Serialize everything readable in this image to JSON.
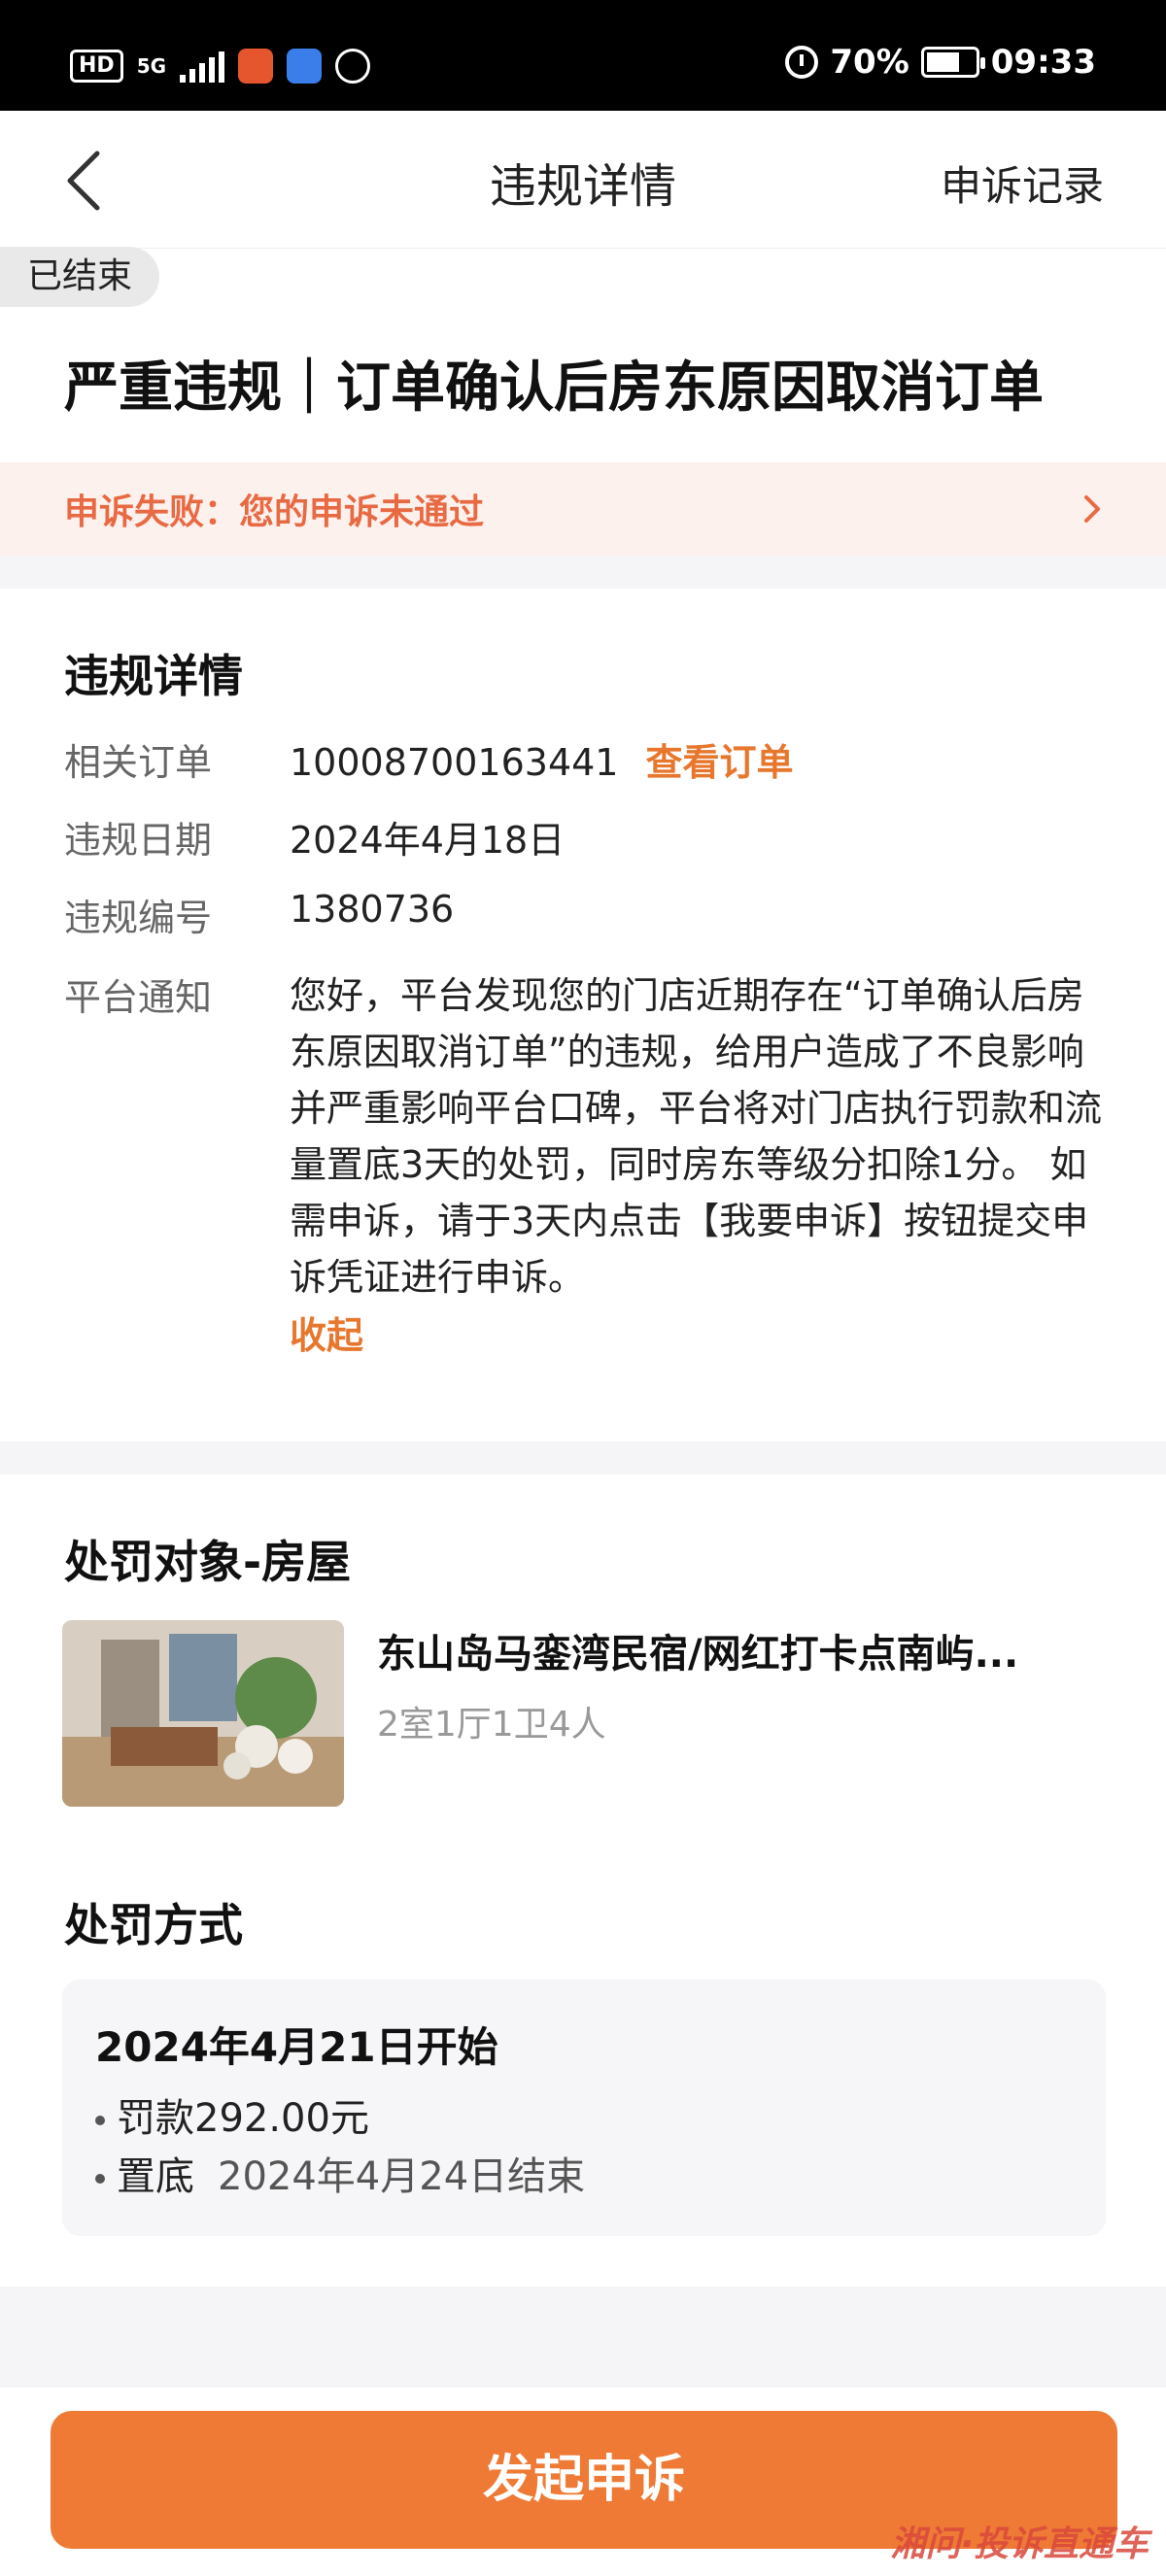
{
  "status_bar": {
    "hd": "HD",
    "net": "5G",
    "battery_pct": "70%",
    "time": "09:33",
    "battery_level": 0.7,
    "icons": [
      "signal-icon",
      "app-icon",
      "baidu-icon",
      "hand-icon",
      "alarm-icon",
      "battery-icon"
    ]
  },
  "nav": {
    "title": "违规详情",
    "right_label": "申诉记录",
    "back_icon": "chevron-left-icon"
  },
  "status_tag": "已结束",
  "headline": "严重违规｜订单确认后房东原因取消订单",
  "appeal_banner": "申诉失败：您的申诉未通过",
  "details": {
    "section_title": "违规详情",
    "order_label": "相关订单",
    "order_value": "10008700163441",
    "order_link": "查看订单",
    "date_label": "违规日期",
    "date_value": "2024年4月18日",
    "number_label": "违规编号",
    "number_value": "1380736",
    "notice_label": "平台通知",
    "notice_text": "您好，平台发现您的门店近期存在“订单确认后房东原因取消订单”的违规，给用户造成了不良影响并严重影响平台口碑，平台将对门店执行罚款和流量置底3天的处罚，同时房东等级分扣除1分。 如需申诉，请于3天内点击【我要申诉】按钮提交申诉凭证进行申诉。",
    "collapse_label": "收起"
  },
  "target": {
    "section_title": "处罚对象-房屋",
    "house_title": "东山岛马銮湾民宿/网红打卡点南屿...",
    "house_sub": "2室1厅1卫4人"
  },
  "penalty": {
    "section_title": "处罚方式",
    "start": "2024年4月21日开始",
    "fine": "罚款292.00元",
    "bottom_label": "置底",
    "bottom_end": "2024年4月24日结束"
  },
  "cta_label": "发起申诉",
  "watermark": "湘问·投诉直通车",
  "colors": {
    "accent": "#ee7a35",
    "link": "#e8772e",
    "banner_bg": "#fdf1ee",
    "banner_text": "#e86a43"
  }
}
